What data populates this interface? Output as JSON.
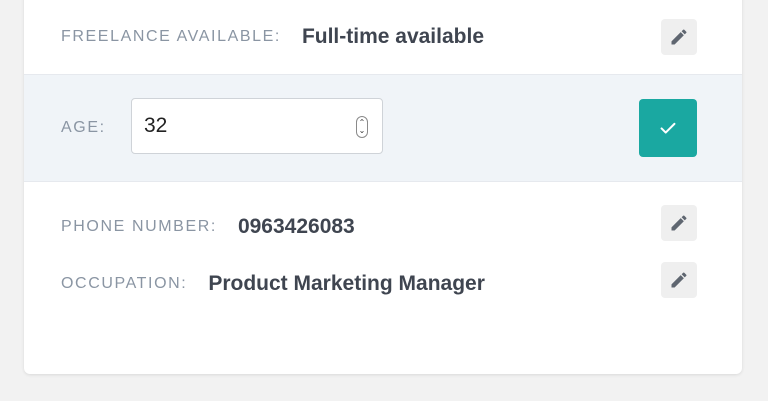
{
  "profile": {
    "freelance": {
      "label": "FREELANCE AVAILABLE:",
      "value": "Full-time available",
      "edit_icon": "pencil-icon"
    },
    "age": {
      "label": "AGE:",
      "value": "32",
      "confirm_icon": "check-icon",
      "confirm_color": "#1aa8a1"
    },
    "phone": {
      "label": "PHONE NUMBER:",
      "value": "0963426083",
      "edit_icon": "pencil-icon"
    },
    "occupation": {
      "label": "OCCUPATION:",
      "value": "Product Marketing Manager",
      "edit_icon": "pencil-icon"
    }
  }
}
